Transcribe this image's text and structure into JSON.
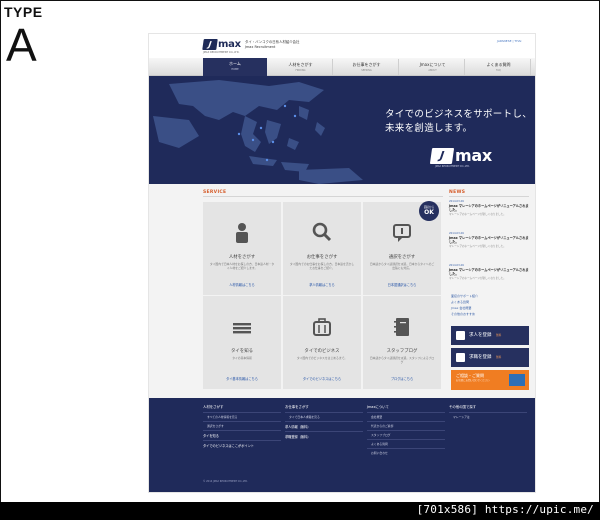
{
  "slide": {
    "type_label": "TYPE",
    "type_letter": "A"
  },
  "watermark": "[701x586] https://upic.me/",
  "header": {
    "logo_text": "max",
    "logo_sub": "JMAX RECRUITMENT CO.,LTD.",
    "tagline_1": "タイ・バンコクの日系人材紹介会社",
    "tagline_2": "Jmax Recruitment",
    "lang": "JAPANESE | THAI"
  },
  "nav": [
    {
      "jp": "ホーム",
      "en": "HOME"
    },
    {
      "jp": "人材をさがす",
      "en": "FINDING"
    },
    {
      "jp": "お仕事をさがす",
      "en": "SEEKING"
    },
    {
      "jp": "Jmaxについて",
      "en": "ABOUT"
    },
    {
      "jp": "よくある質問",
      "en": "FAQ"
    }
  ],
  "hero": {
    "copy_1": "タイでのビジネスをサポートし、",
    "copy_2": "未来を創造します。",
    "logo_text": "max",
    "logo_sub": "JMAX RECRUITMENT CO.,LTD.",
    "map_color": "#3a4f86",
    "label_color": "#5b8ee8"
  },
  "service": {
    "title": "SERVICE",
    "badge_small": "面接から",
    "badge_big": "OK",
    "cards": [
      {
        "title": "人材をさがす",
        "desc": "タイ国内で日本人材をお探しの方、日本語人材・タイ人材をご紹介します。",
        "link": "人材情報はこちら",
        "icon": "person-icon"
      },
      {
        "title": "お仕事をさがす",
        "desc": "タイ国内でのお仕事をお探しの方。日本語を活かしたお仕事をご紹介。",
        "link": "求人情報はこちら",
        "icon": "search-icon"
      },
      {
        "title": "通訳をさがす",
        "desc": "日本語からタイ語通訳を派遣。日本からタイへのご出張にも対応。",
        "link": "日本語通訳はこちら",
        "icon": "speech-bubble-icon"
      },
      {
        "title": "タイを知る",
        "desc": "タイの基本情報",
        "link": "タイ基本情報はこちら",
        "icon": "menu-lines-icon"
      },
      {
        "title": "タイでのビジネス",
        "desc": "タイ国内でのビジネスをはじめるまで。",
        "link": "タイでのビジネスはこちら",
        "icon": "briefcase-icon"
      },
      {
        "title": "スタッフブログ",
        "desc": "日本語からタイ語通訳を派遣。スタッフによるブログ",
        "link": "ブログはこちら",
        "icon": "notebook-icon"
      }
    ]
  },
  "news": {
    "title": "NEWS",
    "items": [
      {
        "date": "2014.03.26",
        "title": "Jmax マレーシアのホームページがリニューアルされました。",
        "text": "マレーシアのホームページが新しくなりました。"
      },
      {
        "date": "2014.03.26",
        "title": "Jmax マレーシアのホームページがリニューアルされました。",
        "text": "マレーシアのホームページが新しくなりました。"
      },
      {
        "date": "2014.03.26",
        "title": "Jmax マレーシアのホームページがリニューアルされました。",
        "text": "マレーシアのホームページが新しくなりました。"
      }
    ],
    "links": [
      "面接のサポート紹介",
      "よくある質問",
      "Jmax 会社概要",
      "その他のおすすめ"
    ],
    "btn_register": "求人を登録",
    "btn_register_sub": "無料",
    "btn_apply": "求職を登録",
    "btn_apply_sub": "無料",
    "orange_title": "ご相談・ご質問",
    "orange_sub": "お気軽にお問い合わせください"
  },
  "footer": {
    "col1": {
      "head": "人材をさがす",
      "subs": [
        "すべての人材情報を見る",
        "通訳をさがす"
      ],
      "mains": [
        "タイを知る",
        "タイでのビジネスはここがポイント"
      ]
    },
    "col2": {
      "head": "お仕事をさがす",
      "subs": [
        "タイで日本人求職を見る"
      ],
      "mains": [
        "求人情報（無料）",
        "求職登録（無料）"
      ]
    },
    "col3": {
      "head": "Jmaxについて",
      "subs": [
        "会社概要",
        "代表からのご挨拶",
        "スタッフブログ",
        "よくある質問",
        "お問い合わせ"
      ],
      "mains": []
    },
    "col4": {
      "head": "その他の国で探す",
      "subs": [
        "マレーシアは"
      ],
      "mains": []
    },
    "copyright": "© 2014 JMAX RECRUITMENT CO.,LTD."
  }
}
